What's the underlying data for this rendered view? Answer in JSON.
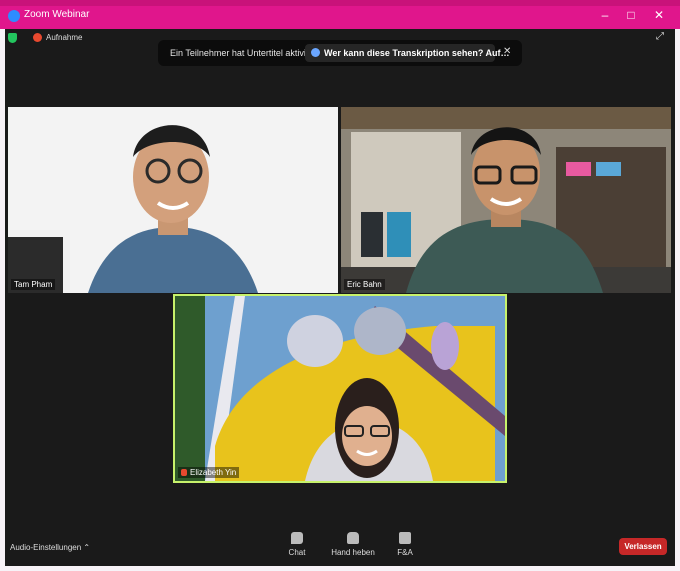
{
  "window": {
    "title": "Zoom Webinar",
    "minimize_symbol": "–",
    "maximize_symbol": "□",
    "close_symbol": "✕"
  },
  "top_status": {
    "recording_label": "Aufnahme",
    "expand_symbol": "⤢"
  },
  "banner": {
    "text": "Ein Teilnehmer hat Untertitel aktiviert",
    "link_text": "Wer kann diese Transkription sehen? Auf…",
    "close_symbol": "✕"
  },
  "participants": [
    {
      "name": "Tam Pham"
    },
    {
      "name": "Eric Bahn"
    },
    {
      "name": "Elizabeth Yin"
    }
  ],
  "bottom": {
    "audio_label": "Audio-Einstellungen  ⌃",
    "chat_label": "Chat",
    "raise_hand_label": "Hand heben",
    "qa_label": "F&A",
    "leave_label": "Verlassen"
  },
  "colors": {
    "titlebar": "#e0168c",
    "leave": "#c62828",
    "active_speaker": "#c7f26b"
  }
}
